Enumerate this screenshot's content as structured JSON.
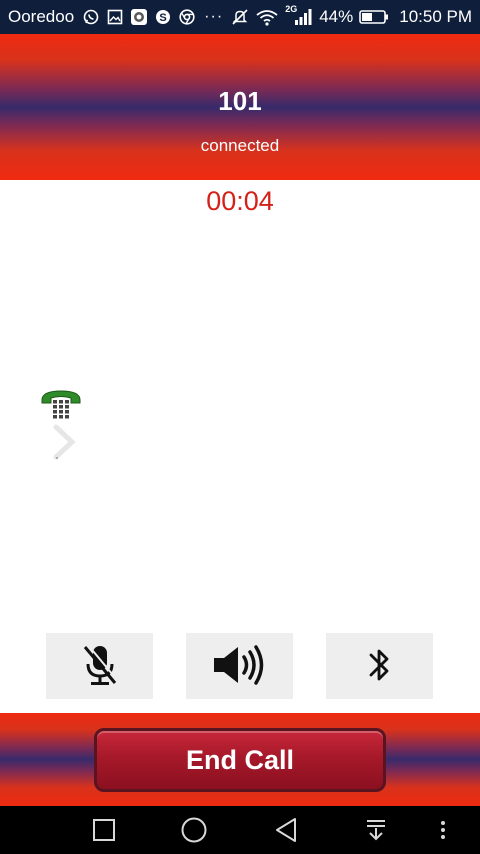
{
  "status_bar": {
    "carrier": "Ooredoo",
    "battery_percent": "44%",
    "time": "10:50 PM",
    "network_type": "2G",
    "notification_icons": [
      "whatsapp-icon",
      "image-icon",
      "app-icon",
      "skype-icon",
      "chrome-icon"
    ],
    "more_indicator": "···"
  },
  "call": {
    "number": "101",
    "status": "connected",
    "timer": "00:04"
  },
  "controls": {
    "mute_icon": "microphone-off-icon",
    "speaker_icon": "speaker-icon",
    "bluetooth_icon": "bluetooth-icon"
  },
  "footer": {
    "end_call_label": "End Call"
  },
  "colors": {
    "accent_red": "#ef2a10",
    "band_purple": "#372a6b",
    "timer_red": "#d3221a",
    "end_call_button": "#a6192a",
    "status_bar": "#0f1f3b"
  }
}
